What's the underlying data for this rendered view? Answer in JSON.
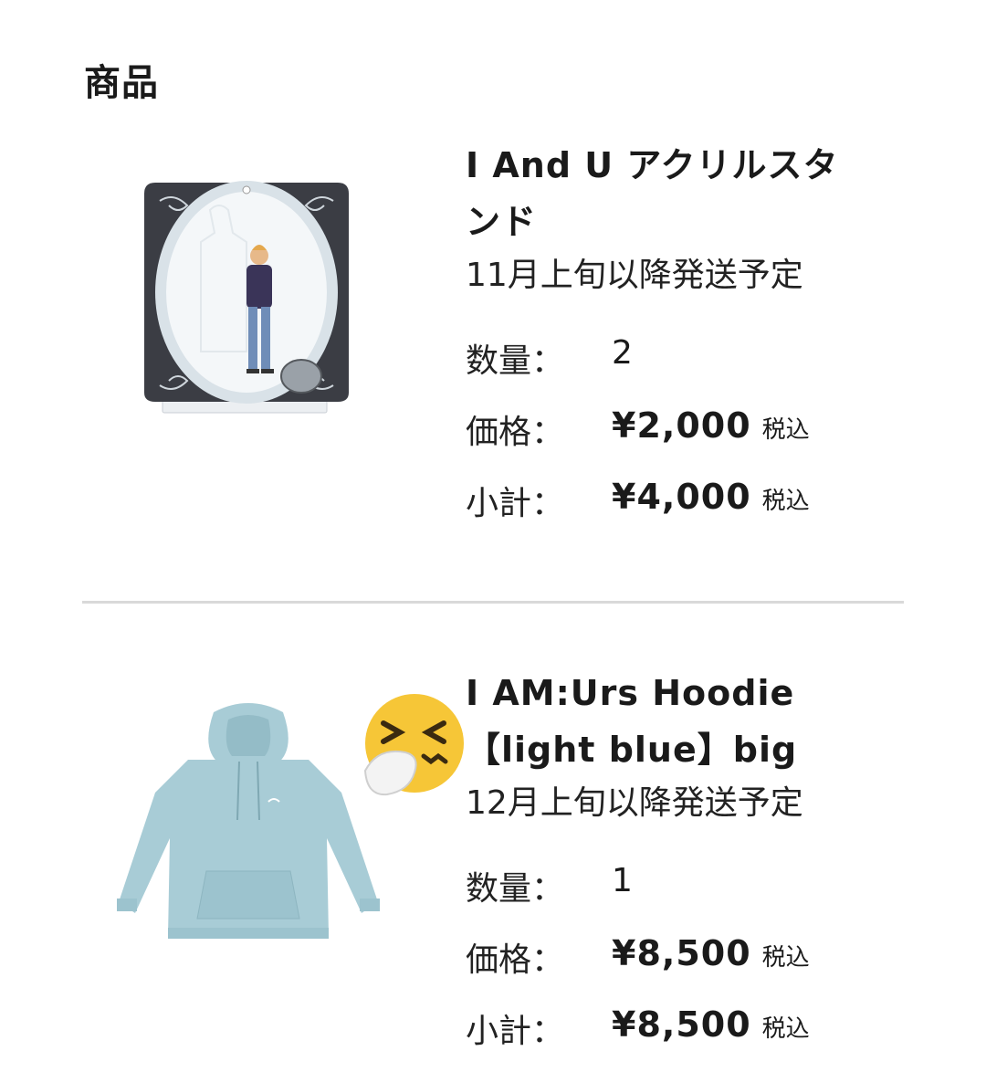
{
  "section": {
    "title": "商品"
  },
  "items": [
    {
      "name": "I And U アクリルスタンド",
      "name_line1": "I And U アクリルスタ",
      "name_line2": "ンド",
      "shipping": "11月上旬以降発送予定",
      "quantity_label": "数量：",
      "quantity": "2",
      "price_label": "価格：",
      "price": "¥2,000",
      "subtotal_label": "小計：",
      "subtotal": "¥4,000",
      "tax_label": "税込",
      "image_icon": "acrylic-stand-image"
    },
    {
      "name": "I AM:Urs Hoodie 【light blue】big",
      "name_line1": "I AM:Urs Hoodie",
      "name_line2": "【light blue】big",
      "shipping": "12月上旬以降発送予定",
      "quantity_label": "数量：",
      "quantity": "1",
      "price_label": "価格：",
      "price": "¥8,500",
      "subtotal_label": "小計：",
      "subtotal": "¥8,500",
      "tax_label": "税込",
      "image_icon": "hoodie-image"
    }
  ],
  "overlay": {
    "emoji": "sneezing-face-emoji"
  },
  "colors": {
    "hoodie": "#a8ccd6",
    "frame": "#3b3d44",
    "divider": "#d9d9d9",
    "emoji": "#f6c637"
  }
}
